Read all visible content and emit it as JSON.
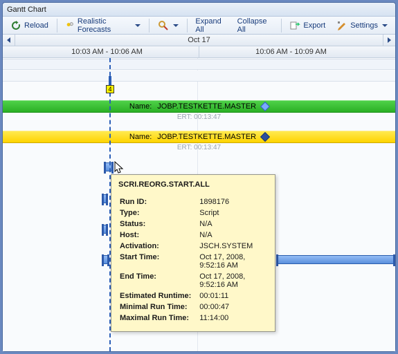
{
  "title": "Gantt Chart",
  "toolbar": {
    "reload": "Reload",
    "realistic": "Realistic Forecasts",
    "expand_all": "Expand All",
    "collapse_all": "Collapse All",
    "export": "Export",
    "settings": "Settings"
  },
  "date_header": "Oct 17",
  "time_cols": [
    "10:03 AM - 10:06 AM",
    "10:06 AM - 10:09 AM"
  ],
  "now_marker": "4",
  "bars": {
    "green_label": "Name:",
    "green_name": "JOBP.TESTKETTE.MASTER",
    "green_ert": "ERT: 00:13:47",
    "yellow_label": "Name:",
    "yellow_name": "JOBP.TESTKETTE.MASTER",
    "yellow_ert": "ERT: 00:13:47"
  },
  "tooltip": {
    "title": "SCRI.REORG.START.ALL",
    "rows": [
      {
        "k": "Run ID:",
        "v": "1898176"
      },
      {
        "k": "Type:",
        "v": "Script"
      },
      {
        "k": "Status:",
        "v": "N/A"
      },
      {
        "k": "Host:",
        "v": "N/A"
      },
      {
        "k": "Activation:",
        "v": "JSCH.SYSTEM"
      },
      {
        "k": "Start Time:",
        "v": "Oct 17, 2008, 9:52:16 AM"
      },
      {
        "k": "End Time:",
        "v": "Oct 17, 2008, 9:52:16 AM"
      },
      {
        "k": "Estimated Runtime:",
        "v": "00:01:11"
      },
      {
        "k": "Minimal Run Time:",
        "v": "00:00:47"
      },
      {
        "k": "Maximal Run Time:",
        "v": "11:14:00"
      }
    ]
  }
}
